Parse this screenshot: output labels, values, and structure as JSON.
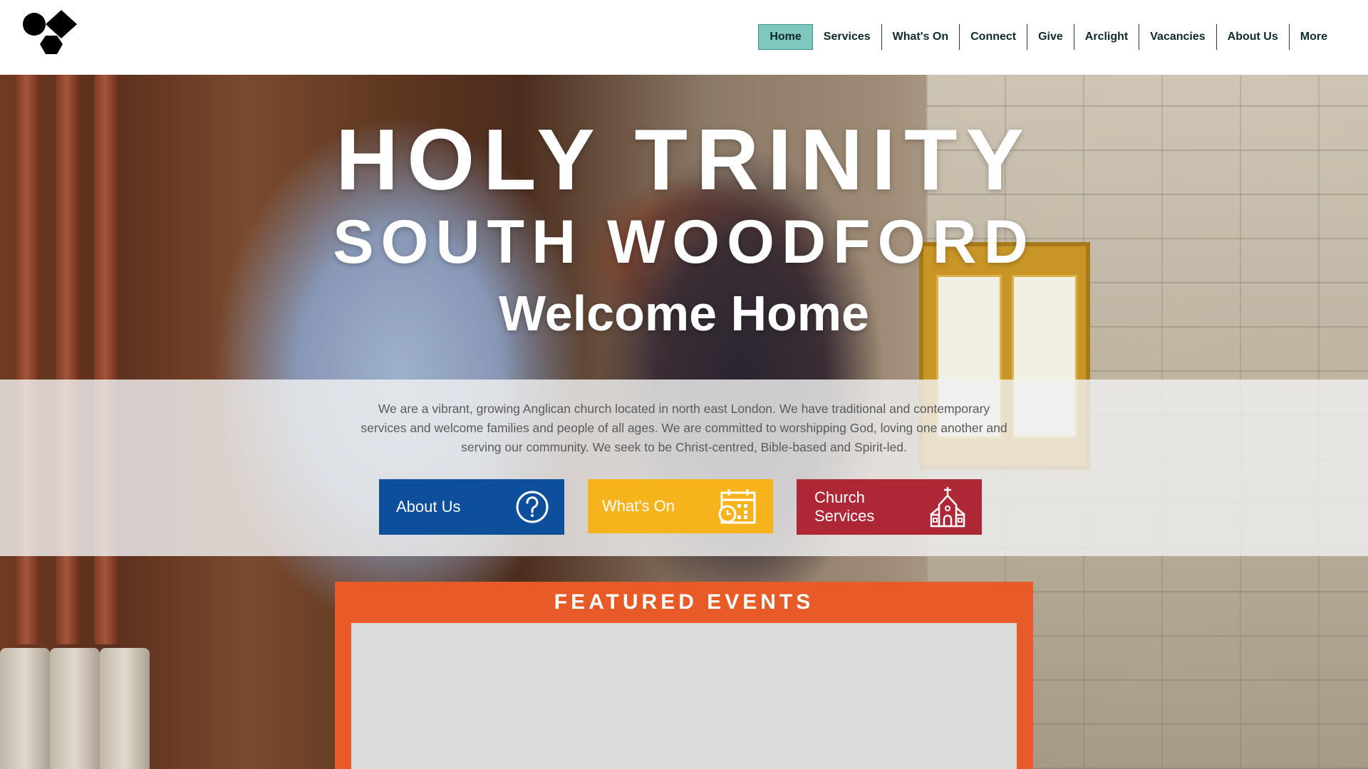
{
  "brand": {
    "logo_icon": "geometric-shapes-logo"
  },
  "nav": {
    "items": [
      {
        "label": "Home",
        "active": true
      },
      {
        "label": "Services",
        "active": false
      },
      {
        "label": "What's On",
        "active": false
      },
      {
        "label": "Connect",
        "active": false
      },
      {
        "label": "Give",
        "active": false
      },
      {
        "label": "Arclight",
        "active": false
      },
      {
        "label": "Vacancies",
        "active": false
      },
      {
        "label": "About Us",
        "active": false
      },
      {
        "label": "More",
        "active": false
      }
    ],
    "active_color": "#7fc8c0"
  },
  "hero": {
    "title_line1": "HOLY TRINITY",
    "title_line2": "SOUTH WOODFORD",
    "tagline": "Welcome Home",
    "intro": "We are a vibrant, growing Anglican church located in north east London. We have traditional and contemporary services and welcome families and people of all ages. We are committed to worshipping God, loving one another and serving our community. We seek to be Christ-centred, Bible-based and Spirit-led."
  },
  "cta": {
    "about": {
      "label": "About Us",
      "icon": "question-circle-icon",
      "color": "#0d4f9a"
    },
    "whats_on": {
      "label": "What's On",
      "icon": "calendar-clock-icon",
      "color": "#f7b31b"
    },
    "services": {
      "label": "Church Services",
      "icon": "church-icon",
      "color": "#ad2736"
    }
  },
  "events": {
    "title": "FEATURED EVENTS",
    "color": "#e85a26"
  }
}
